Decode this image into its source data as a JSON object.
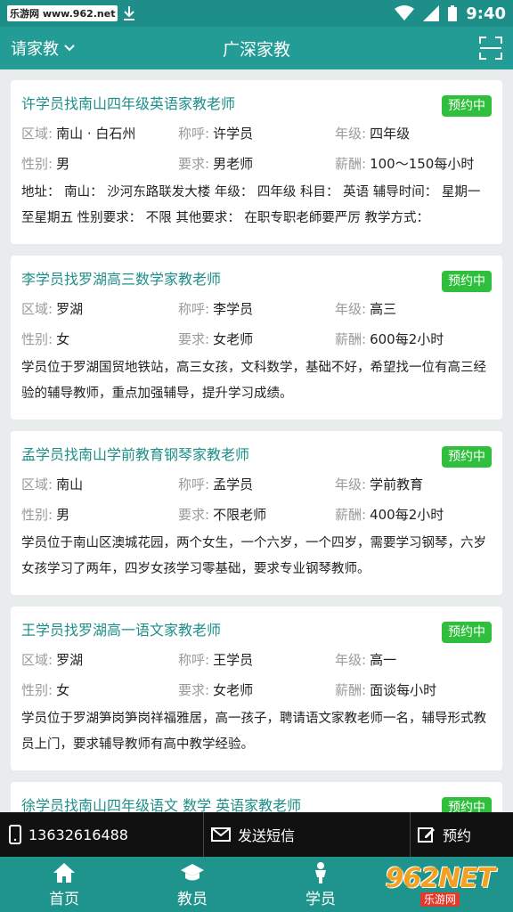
{
  "status_bar": {
    "watermark": "乐游网 www.962.net",
    "time": "9:40"
  },
  "app_bar": {
    "city": "请家教",
    "title": "广深家教"
  },
  "labels": {
    "area": "区域:",
    "name": "称呼:",
    "grade": "年级:",
    "gender": "性别:",
    "req": "要求:",
    "pay": "薪酬:"
  },
  "cards": [
    {
      "title": "许学员找南山四年级英语家教老师",
      "badge": "预约中",
      "area": "南山 · 白石州",
      "name": "许学员",
      "grade": "四年级",
      "gender": "男",
      "req": "男老师",
      "pay": "100～150每小时",
      "desc": "地址： 南山： 沙河东路联发大楼 年级： 四年级 科目： 英语 辅导时间： 星期一至星期五 性别要求： 不限 其他要求： 在职专职老師要严厉 教学方式："
    },
    {
      "title": "李学员找罗湖高三数学家教老师",
      "badge": "预约中",
      "area": "罗湖",
      "name": "李学员",
      "grade": "高三",
      "gender": "女",
      "req": "女老师",
      "pay": "600每2小时",
      "desc": "学员位于罗湖国贸地铁站，高三女孩，文科数学，基础不好，希望找一位有高三经验的辅导教师，重点加强辅导，提升学习成绩。"
    },
    {
      "title": "孟学员找南山学前教育钢琴家教老师",
      "badge": "预约中",
      "area": "南山",
      "name": "孟学员",
      "grade": "学前教育",
      "gender": "男",
      "req": "不限老师",
      "pay": "400每2小时",
      "desc": "学员位于南山区澳城花园，两个女生，一个六岁，一个四岁，需要学习钢琴，六岁女孩学习了两年，四岁女孩学习零基础，要求专业钢琴教师。"
    },
    {
      "title": "王学员找罗湖高一语文家教老师",
      "badge": "预约中",
      "area": "罗湖",
      "name": "王学员",
      "grade": "高一",
      "gender": "女",
      "req": "女老师",
      "pay": "面谈每小时",
      "desc": "学员位于罗湖笋岗笋岗祥福雅居，高一孩子，聘请语文家教老师一名，辅导形式教员上门，要求辅导教师有高中教学经验。"
    },
    {
      "title": "徐学员找南山四年级语文 数学 英语家教老师",
      "badge": "预约中",
      "area": "",
      "name": "",
      "grade": "",
      "gender": "",
      "req": "",
      "pay": "",
      "desc": ""
    }
  ],
  "contact": {
    "phone": "13632616488",
    "sms": "发送短信",
    "book": "预约"
  },
  "tabs": [
    {
      "label": "首页"
    },
    {
      "label": "教员"
    },
    {
      "label": "学员"
    }
  ],
  "corner_watermark": {
    "big": "962NET",
    "small": "乐游网"
  },
  "colors": {
    "primary": "#239c95",
    "badge": "#2fbf3c",
    "title": "#1e8f88"
  }
}
